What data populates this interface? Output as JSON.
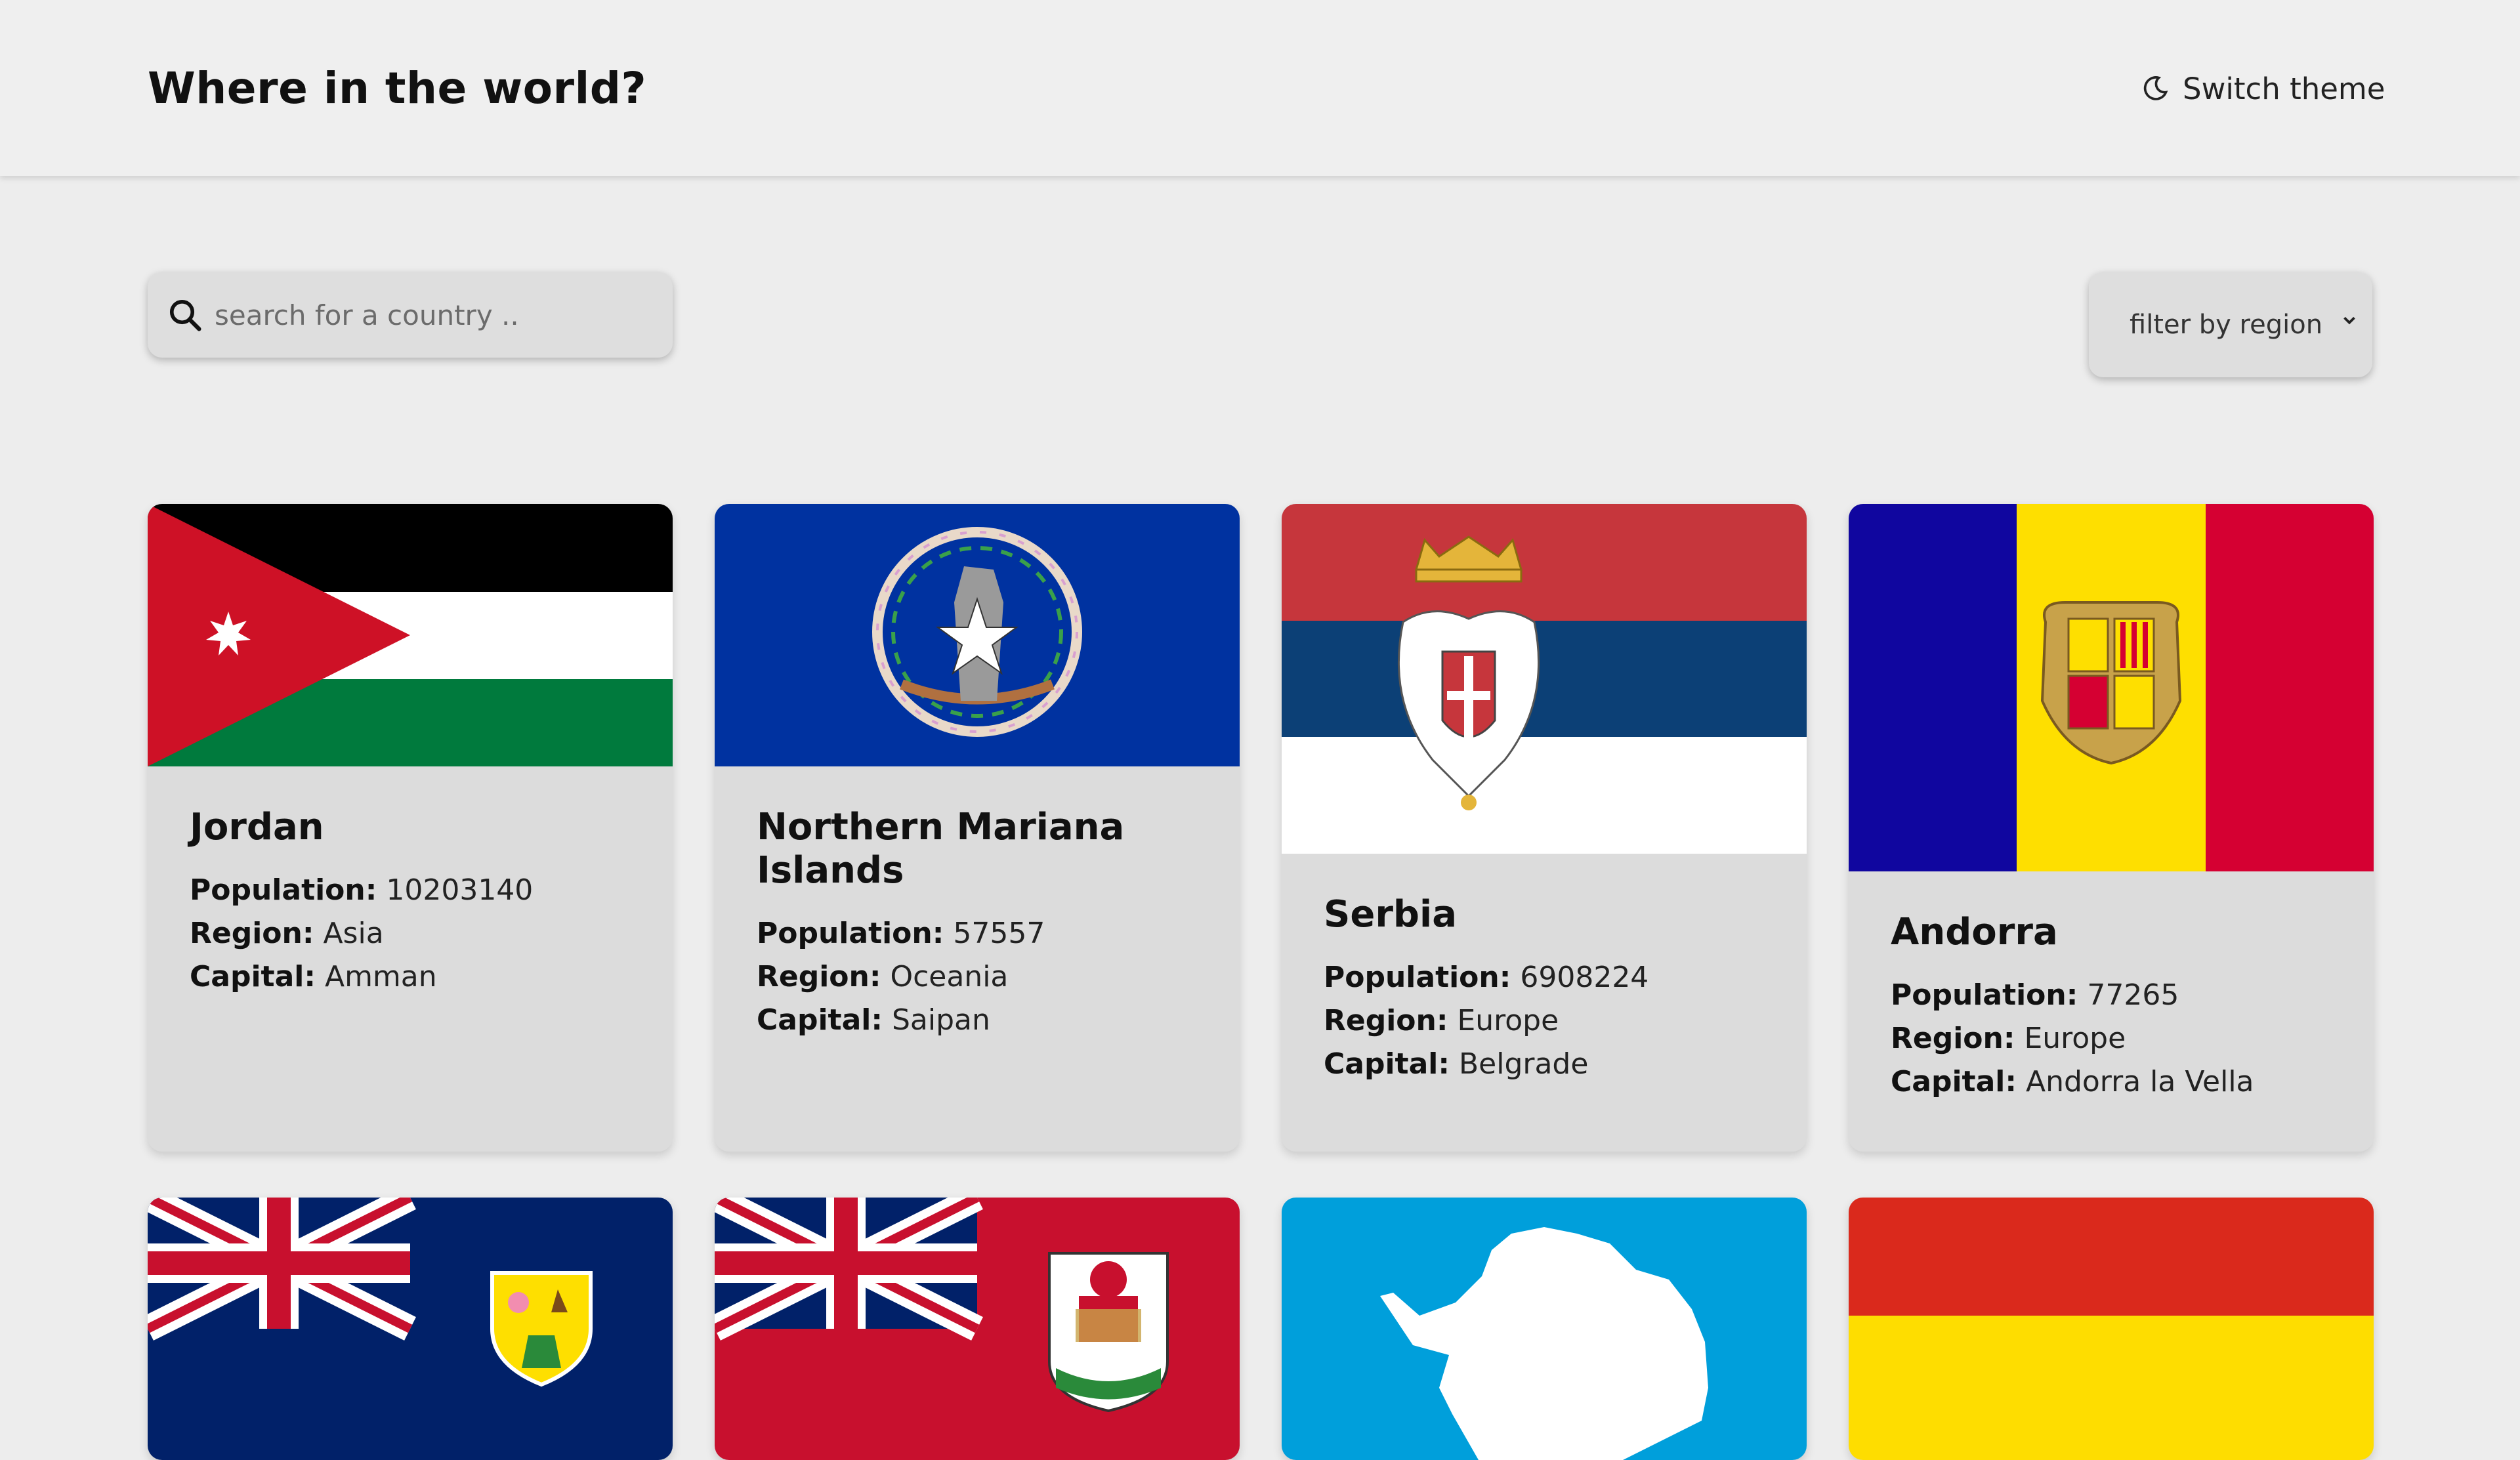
{
  "header": {
    "title": "Where in the world?",
    "theme_toggle_label": "Switch theme",
    "theme_icon": "moon-icon"
  },
  "search": {
    "placeholder": "search for a country ..",
    "value": "",
    "icon": "search-icon"
  },
  "filter": {
    "selected": "filter by region",
    "icon": "chevron-down-icon"
  },
  "labels": {
    "population": "Population:",
    "region": "Region:",
    "capital": "Capital:"
  },
  "countries": [
    {
      "name": "Jordan",
      "population": "10203140",
      "region": "Asia",
      "capital": "Amman",
      "flag": "jordan-flag"
    },
    {
      "name": "Northern Mariana Islands",
      "population": "57557",
      "region": "Oceania",
      "capital": "Saipan",
      "flag": "northern-mariana-islands-flag"
    },
    {
      "name": "Serbia",
      "population": "6908224",
      "region": "Europe",
      "capital": "Belgrade",
      "flag": "serbia-flag"
    },
    {
      "name": "Andorra",
      "population": "77265",
      "region": "Europe",
      "capital": "Andorra la Vella",
      "flag": "andorra-flag"
    },
    {
      "name": "",
      "flag": "turks-and-caicos-flag"
    },
    {
      "name": "",
      "flag": "bermuda-flag"
    },
    {
      "name": "",
      "flag": "antarctica-flag"
    },
    {
      "name": "",
      "flag": "red-yellow-flag"
    }
  ],
  "colors": {
    "background": "#ededed",
    "header": "#efefef",
    "card": "#dcdcdc",
    "text": "#111111"
  }
}
